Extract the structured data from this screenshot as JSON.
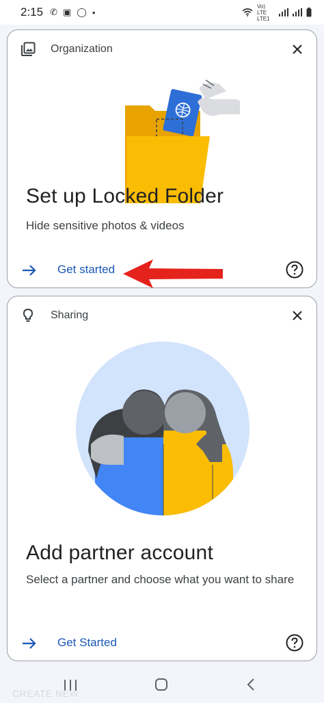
{
  "status_bar": {
    "time": "2:15",
    "network": "Vo) LTE LTE1"
  },
  "cards": [
    {
      "category": "Organization",
      "title": "Set up Locked Folder",
      "subtitle": "Hide sensitive photos & videos",
      "action": "Get started"
    },
    {
      "category": "Sharing",
      "title": "Add partner account",
      "subtitle": "Select a partner and choose what you want to share",
      "action": "Get Started"
    }
  ],
  "colors": {
    "accent_blue": "#1a57b5",
    "folder_yellow": "#fbbc04",
    "annotation_red": "#e5231d",
    "card_border": "#9aa0a6"
  },
  "watermark": "CREATE NEW"
}
